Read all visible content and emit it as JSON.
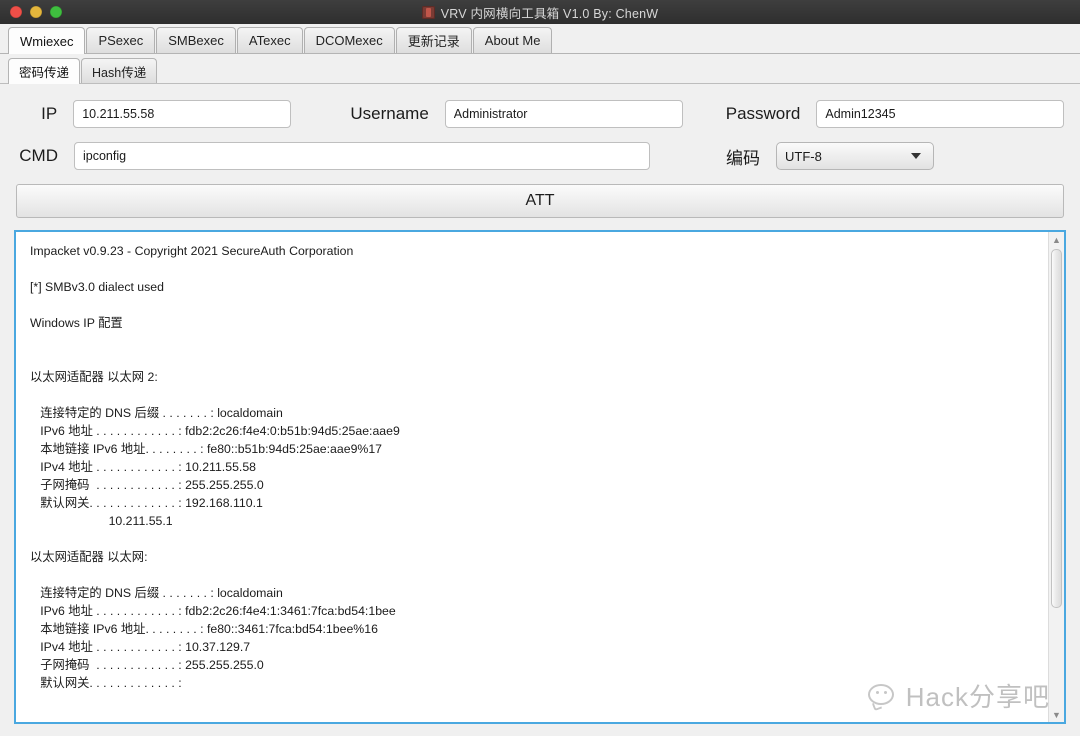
{
  "window": {
    "title": "VRV 内网横向工具箱 V1.0 By: ChenW",
    "app_icon": "app-icon",
    "traffic_lights": {
      "close": "close-button",
      "minimize": "minimize-button",
      "maximize": "maximize-button"
    },
    "colors": {
      "titlebar_bg": "#2e2e2e",
      "window_bg": "#f0f0f0",
      "console_border": "#4aa8e0",
      "close_red": "#ef4f48",
      "minimize_yellow": "#e4b63c",
      "maximize_green": "#3fbe3f"
    }
  },
  "main_tabs": [
    {
      "label": "Wmiexec",
      "active": true
    },
    {
      "label": "PSexec",
      "active": false
    },
    {
      "label": "SMBexec",
      "active": false
    },
    {
      "label": "ATexec",
      "active": false
    },
    {
      "label": "DCOMexec",
      "active": false
    },
    {
      "label": "更新记录",
      "active": false
    },
    {
      "label": "About Me",
      "active": false
    }
  ],
  "sub_tabs": [
    {
      "label": "密码传递",
      "active": true
    },
    {
      "label": "Hash传递",
      "active": false
    }
  ],
  "form": {
    "ip_label": "IP",
    "ip_value": "10.211.55.58",
    "ip_placeholder": "",
    "username_label": "Username",
    "username_value": "Administrator",
    "username_placeholder": "",
    "password_label": "Password",
    "password_value": "Admin12345",
    "password_placeholder": "",
    "cmd_label": "CMD",
    "cmd_value": "ipconfig",
    "cmd_placeholder": "",
    "encoding_label": "编码",
    "encoding_value": "UTF-8",
    "encoding_caret": "chevron-down-icon"
  },
  "action": {
    "attack_label": "ATT"
  },
  "console": {
    "lines": [
      "Impacket v0.9.23 - Copyright 2021 SecureAuth Corporation",
      "",
      "[*] SMBv3.0 dialect used",
      "",
      "Windows IP 配置",
      "",
      "",
      "以太网适配器 以太网 2:",
      "",
      "   连接特定的 DNS 后缀 . . . . . . . : localdomain",
      "   IPv6 地址 . . . . . . . . . . . . : fdb2:2c26:f4e4:0:b51b:94d5:25ae:aae9",
      "   本地链接 IPv6 地址. . . . . . . . : fe80::b51b:94d5:25ae:aae9%17",
      "   IPv4 地址 . . . . . . . . . . . . : 10.211.55.58",
      "   子网掩码  . . . . . . . . . . . . : 255.255.255.0",
      "   默认网关. . . . . . . . . . . . . : 192.168.110.1",
      "                       10.211.55.1",
      "",
      "以太网适配器 以太网:",
      "",
      "   连接特定的 DNS 后缀 . . . . . . . : localdomain",
      "   IPv6 地址 . . . . . . . . . . . . : fdb2:2c26:f4e4:1:3461:7fca:bd54:1bee",
      "   本地链接 IPv6 地址. . . . . . . . : fe80::3461:7fca:bd54:1bee%16",
      "   IPv4 地址 . . . . . . . . . . . . : 10.37.129.7",
      "   子网掩码  . . . . . . . . . . . . : 255.255.255.0",
      "   默认网关. . . . . . . . . . . . . :"
    ],
    "scrollbar": {
      "up_arrow": "scroll-up-arrow-icon",
      "down_arrow": "scroll-down-arrow-icon",
      "thumb_position_percent": 0,
      "thumb_size_percent": 78
    }
  },
  "watermark": {
    "text": "Hack分享吧",
    "icon": "speech-bubble-icon"
  }
}
